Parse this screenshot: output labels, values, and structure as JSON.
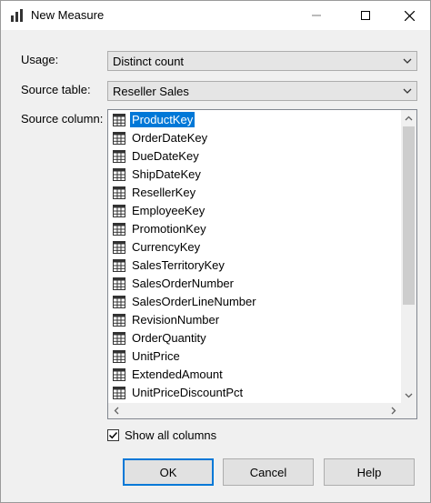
{
  "window": {
    "title": "New Measure",
    "icon": "measure-bar-chart-icon"
  },
  "form": {
    "usage_label": "Usage:",
    "usage_value": "Distinct count",
    "source_table_label": "Source table:",
    "source_table_value": "Reseller Sales",
    "source_column_label": "Source column:"
  },
  "columns": [
    {
      "label": "ProductKey",
      "selected": true
    },
    {
      "label": "OrderDateKey"
    },
    {
      "label": "DueDateKey"
    },
    {
      "label": "ShipDateKey"
    },
    {
      "label": "ResellerKey"
    },
    {
      "label": "EmployeeKey"
    },
    {
      "label": "PromotionKey"
    },
    {
      "label": "CurrencyKey"
    },
    {
      "label": "SalesTerritoryKey"
    },
    {
      "label": "SalesOrderNumber"
    },
    {
      "label": "SalesOrderLineNumber"
    },
    {
      "label": "RevisionNumber"
    },
    {
      "label": "OrderQuantity"
    },
    {
      "label": "UnitPrice"
    },
    {
      "label": "ExtendedAmount"
    },
    {
      "label": "UnitPriceDiscountPct"
    }
  ],
  "show_all": {
    "label": "Show all columns",
    "checked": true
  },
  "buttons": {
    "ok": "OK",
    "cancel": "Cancel",
    "help": "Help"
  },
  "colors": {
    "selection": "#0078d7",
    "default_button_border": "#0078d7"
  }
}
